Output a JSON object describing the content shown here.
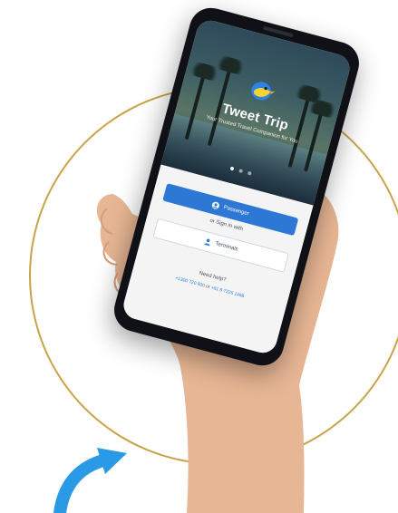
{
  "app": {
    "title": "Tweet Trip",
    "tagline": "Your Trusted Travel Companion for You"
  },
  "login": {
    "primary_button": "Passenger",
    "or_text": "or Sign in with",
    "secondary_button": "Terminals"
  },
  "help": {
    "label": "Need help?",
    "phone_primary": "+1300 720 800",
    "separator": "or",
    "phone_secondary": "+61 8 7226 1468"
  },
  "colors": {
    "accent": "#2d78d4",
    "ring": "#c9a24a",
    "arrow": "#2a9ae6"
  },
  "icons": {
    "logo": "bird-logo-icon",
    "primary_button_icon": "user-icon",
    "secondary_button_icon": "person-icon",
    "arrow": "curved-arrow-icon"
  }
}
